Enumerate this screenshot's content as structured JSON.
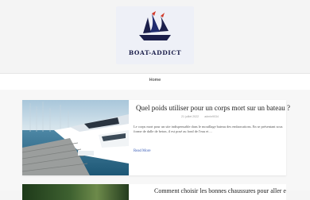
{
  "header": {
    "logo_text": "BOAT-ADDICT",
    "logo_icon": "sailing-ship-icon",
    "brand_color": "#1b1e4a"
  },
  "nav": {
    "home_label": "Home"
  },
  "post": {
    "title": "Quel poids utiliser pour un corps mort sur un bateau ?",
    "date": "21 juillet 2022",
    "author": "admin9034",
    "excerpt": "Le corps mort pour un site indispensable dans le mouillage bateau des embarcations. En se présentant sous forme de dalle de beton, il est posé au fond de l'eau et ...",
    "read_more": "Read More",
    "image": "marina-boats-photo"
  },
  "post2": {
    "title": "Comment choisir les bonnes chaussures pour aller en bateau ?",
    "image": "green-foliage-photo"
  }
}
